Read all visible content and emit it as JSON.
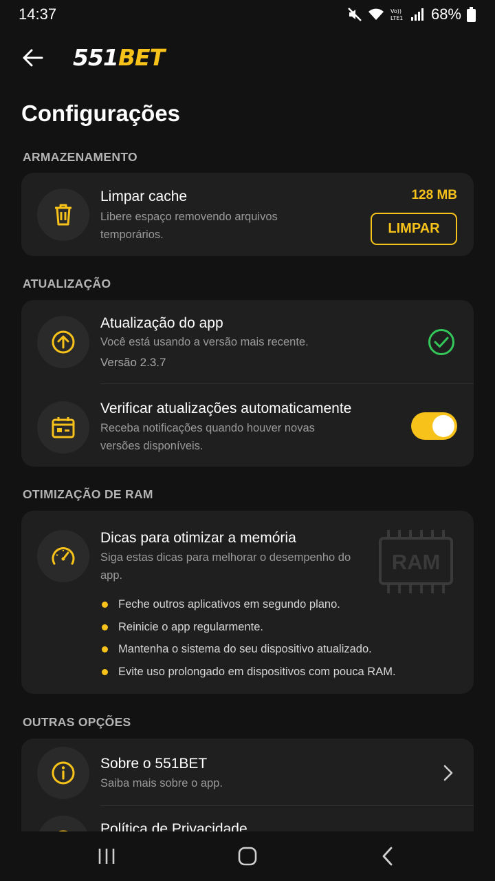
{
  "status_bar": {
    "time": "14:37",
    "battery": "68%",
    "icons": [
      "mute-icon",
      "wifi-icon",
      "volte-icon",
      "signal-icon",
      "battery-icon"
    ]
  },
  "header": {
    "logo_number": "551",
    "logo_word": "BET",
    "back_icon": "arrow-left-icon"
  },
  "page": {
    "title": "Configurações"
  },
  "colors": {
    "accent": "#f7c21a",
    "background": "#121212",
    "card": "#1f1f1f",
    "success": "#34c759"
  },
  "storage": {
    "section_label": "ARMAZENAMENTO",
    "title": "Limpar cache",
    "description": "Libere espaço removendo arquivos temporários.",
    "size": "128 MB",
    "button_label": "LIMPAR",
    "icon": "trash-icon"
  },
  "update": {
    "section_label": "ATUALIZAÇÃO",
    "app_update": {
      "title": "Atualização do app",
      "description": "Você está usando a versão mais recente.",
      "version": "Versão 2.3.7",
      "icon": "arrow-up-circle-icon",
      "status_icon": "check-circle-icon"
    },
    "auto_check": {
      "title": "Verificar atualizações automaticamente",
      "description": "Receba notificações quando houver novas versões disponíveis.",
      "icon": "calendar-icon",
      "enabled": true
    }
  },
  "ram": {
    "section_label": "OTIMIZAÇÃO DE RAM",
    "title": "Dicas para otimizar a memória",
    "description": "Siga estas dicas para melhorar o desempenho do app.",
    "icon": "speedometer-icon",
    "illustration_text": "RAM",
    "tips": [
      "Feche outros aplicativos em segundo plano.",
      "Reinicie o app regularmente.",
      "Mantenha o sistema do seu dispositivo atualizado.",
      "Evite uso prolongado em dispositivos com pouca RAM."
    ]
  },
  "other": {
    "section_label": "OUTRAS OPÇÕES",
    "items": [
      {
        "title": "Sobre o 551BET",
        "description": "Saiba mais sobre o app.",
        "icon": "info-icon"
      },
      {
        "title": "Política de Privacidade",
        "icon": "shield-icon"
      }
    ]
  },
  "nav": {
    "buttons": [
      "recents-icon",
      "home-icon",
      "back-icon"
    ]
  }
}
